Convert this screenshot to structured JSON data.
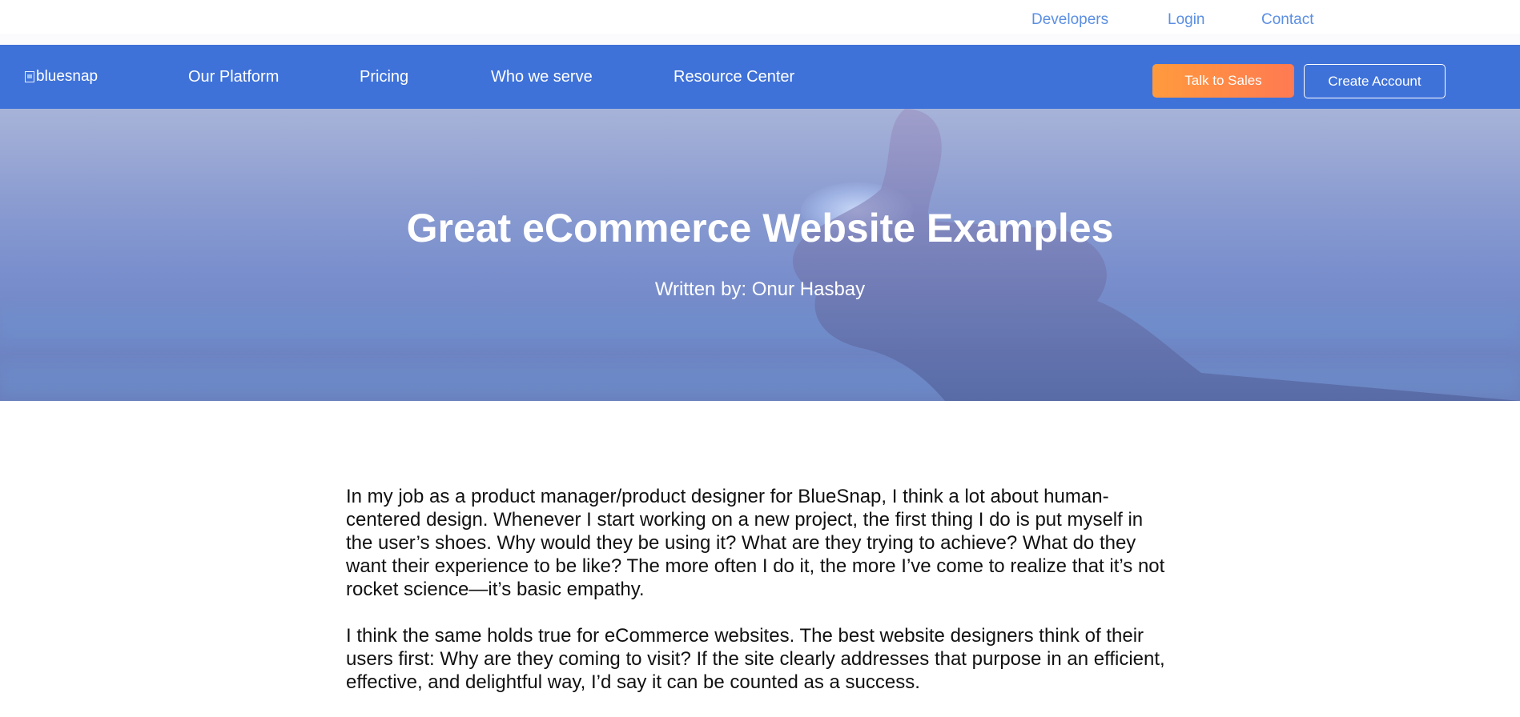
{
  "top_links": {
    "developers": "Developers",
    "login": "Login",
    "contact": "Contact"
  },
  "nav": {
    "logo_alt": "bluesnap",
    "items": [
      "Our Platform",
      "Pricing",
      "Who we serve",
      "Resource Center"
    ],
    "talk_to_sales": "Talk to Sales",
    "create_account": "Create Account"
  },
  "hero": {
    "title": "Great eCommerce Website Examples",
    "byline": "Written by: Onur Hasbay"
  },
  "article": {
    "paragraphs": [
      "In my job as a product manager/product designer for BlueSnap, I think a lot about human-centered design. Whenever I start working on a new project, the first thing I do is put myself in the user’s shoes. Why would they be using it? What are they trying to achieve? What do they want their experience to be like? The more often I do it, the more I’ve come to realize that it’s not rocket science—it’s basic empathy.",
      "I think the same holds true for eCommerce websites. The best website designers think of their users first: Why are they coming to visit? If the site clearly addresses that purpose in an efficient, effective, and delightful way, I’d say it can be counted as a success."
    ]
  },
  "colors": {
    "nav_bg": "#3f72d9",
    "top_link": "#5b8fe3",
    "cta_orange": "#ff8a47"
  }
}
